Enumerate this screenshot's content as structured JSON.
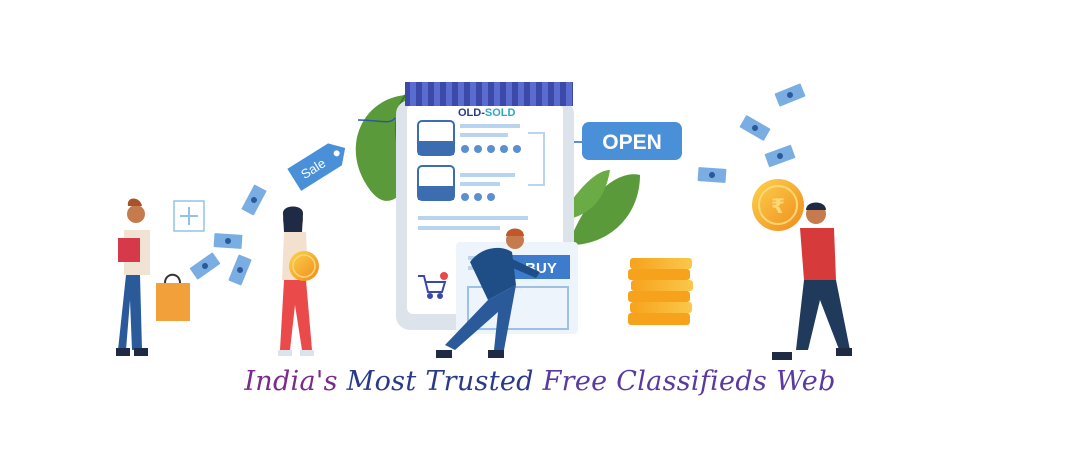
{
  "store": {
    "brand_old": "OLD",
    "brand_sep": "-",
    "brand_sold": "SOLD",
    "open_label": "OPEN",
    "buy_label": "BUY",
    "sale_tag": "Sale",
    "coin_symbol": "₹"
  },
  "tagline": {
    "part1": "India's ",
    "part2": "Most Trusted ",
    "part3": "Free Classifieds Web"
  },
  "colors": {
    "accent_blue": "#4a90d9",
    "awning_dark": "#3b4aa8",
    "leaf_green": "#5a9a3a",
    "coin_gold": "#f7b731",
    "tagline_purple": "#6a3fa0",
    "tagline_blue": "#2a3a8a"
  },
  "icons": [
    "plus-icon",
    "cart-icon",
    "money-note-icon",
    "coin-icon",
    "heart-icon"
  ]
}
